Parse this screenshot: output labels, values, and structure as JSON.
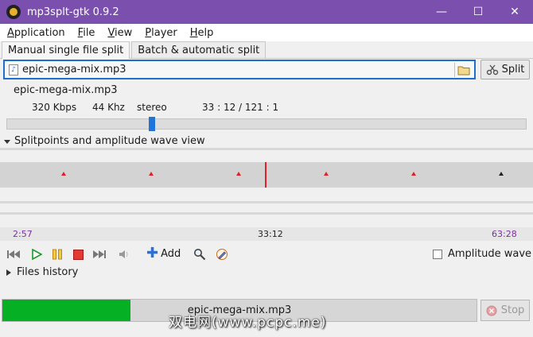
{
  "window": {
    "title": "mp3splt-gtk 0.9.2",
    "minimize_glyph": "—",
    "maximize_glyph": "☐",
    "close_glyph": "✕"
  },
  "menu": {
    "items": [
      "Application",
      "File",
      "View",
      "Player",
      "Help"
    ]
  },
  "tabs": {
    "items": [
      "Manual single file split",
      "Batch & automatic split"
    ],
    "active": 0
  },
  "file": {
    "value": "epic-mega-mix.mp3",
    "folder_icon": "folder-icon",
    "split_label": "Split"
  },
  "track_info": {
    "name": "epic-mega-mix.mp3",
    "bitrate": "320 Kbps",
    "frequency": "44 Khz",
    "mode": "stereo",
    "time": "33 : 12 / 121 : 1",
    "position_fraction": 0.275
  },
  "wave_view": {
    "expander_label": "Splitpoints and amplitude wave view",
    "time_start": "2:57",
    "time_current": "33:12",
    "time_end": "63:28"
  },
  "player": {
    "add_label": "Add",
    "amplitude_label": "Amplitude wave",
    "amplitude_checked": false
  },
  "history": {
    "label": "Files history"
  },
  "status": {
    "progress_text": "epic-mega-mix.mp3",
    "progress_fraction": 0.27,
    "stop_label": "Stop"
  },
  "watermark": "双电网(www.pcpc.me)",
  "colors": {
    "titlebar": "#7b4fae",
    "accent": "#1f73d9",
    "progress": "#06b025",
    "splitpoint": "#e21f2a",
    "time_label": "#7b2fa0"
  }
}
